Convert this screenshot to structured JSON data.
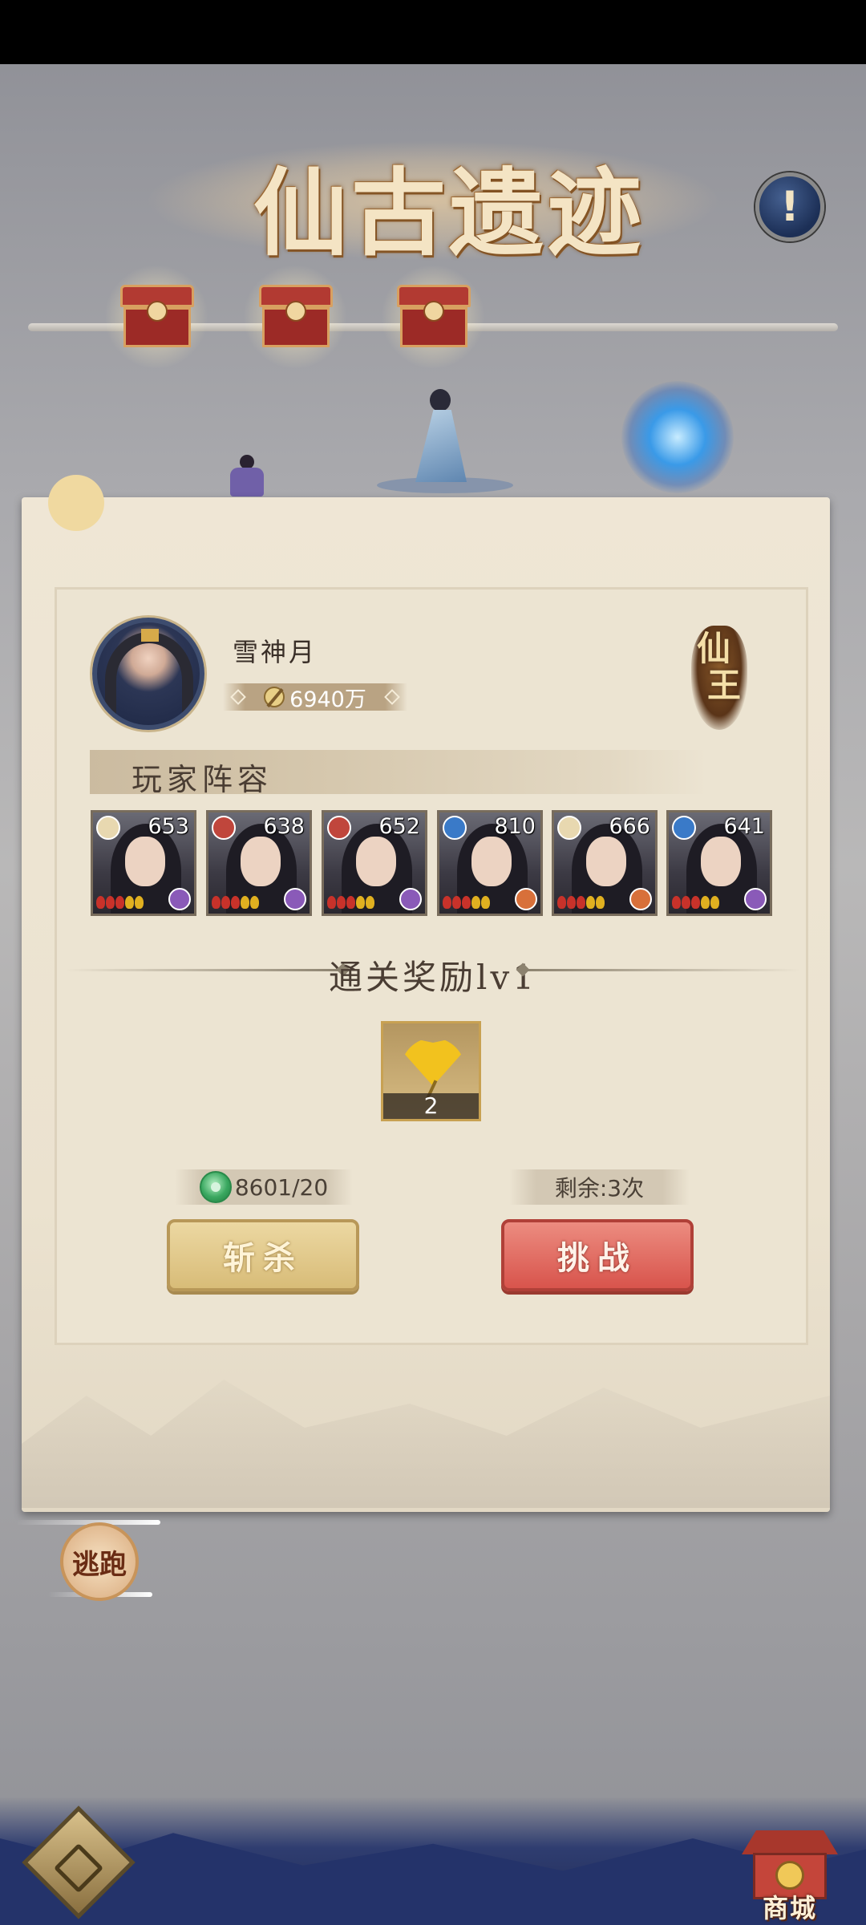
{
  "header": {
    "title": "仙古遗迹",
    "info_icon": "!"
  },
  "progress": {
    "chests": [
      {
        "icon": "treasure-chest-icon"
      },
      {
        "icon": "treasure-chest-icon"
      },
      {
        "icon": "treasure-chest-icon"
      }
    ]
  },
  "player": {
    "name": "雪神月",
    "power": "6940万",
    "rank_badge": [
      "仙",
      "王"
    ]
  },
  "lineup": {
    "title": "玩家阵容",
    "heroes": [
      {
        "level": "653",
        "element_color": "#e8d8b0",
        "stars": 5,
        "class_color": "#8a5ab8"
      },
      {
        "level": "638",
        "element_color": "#c0463c",
        "stars": 5,
        "class_color": "#8a5ab8"
      },
      {
        "level": "652",
        "element_color": "#c0463c",
        "stars": 5,
        "class_color": "#8a5ab8"
      },
      {
        "level": "810",
        "element_color": "#3a7ac8",
        "stars": 5,
        "class_color": "#d8703a"
      },
      {
        "level": "666",
        "element_color": "#e8d8b0",
        "stars": 5,
        "class_color": "#d8703a"
      },
      {
        "level": "641",
        "element_color": "#3a7ac8",
        "stars": 5,
        "class_color": "#8a5ab8"
      }
    ]
  },
  "reward": {
    "title": "通关奖励lv1",
    "item_icon": "ginkgo-leaf-icon",
    "item_count": "2"
  },
  "actions": {
    "cost": "8601/20",
    "remaining": "剩余:3次",
    "kill_label": "斩杀",
    "challenge_label": "挑战"
  },
  "footer": {
    "flee_label": "逃跑",
    "shop_label": "商城"
  },
  "colors": {
    "challenge_button": "#d8544c",
    "kill_button": "#d8bc78",
    "panel": "#efe6d5"
  }
}
